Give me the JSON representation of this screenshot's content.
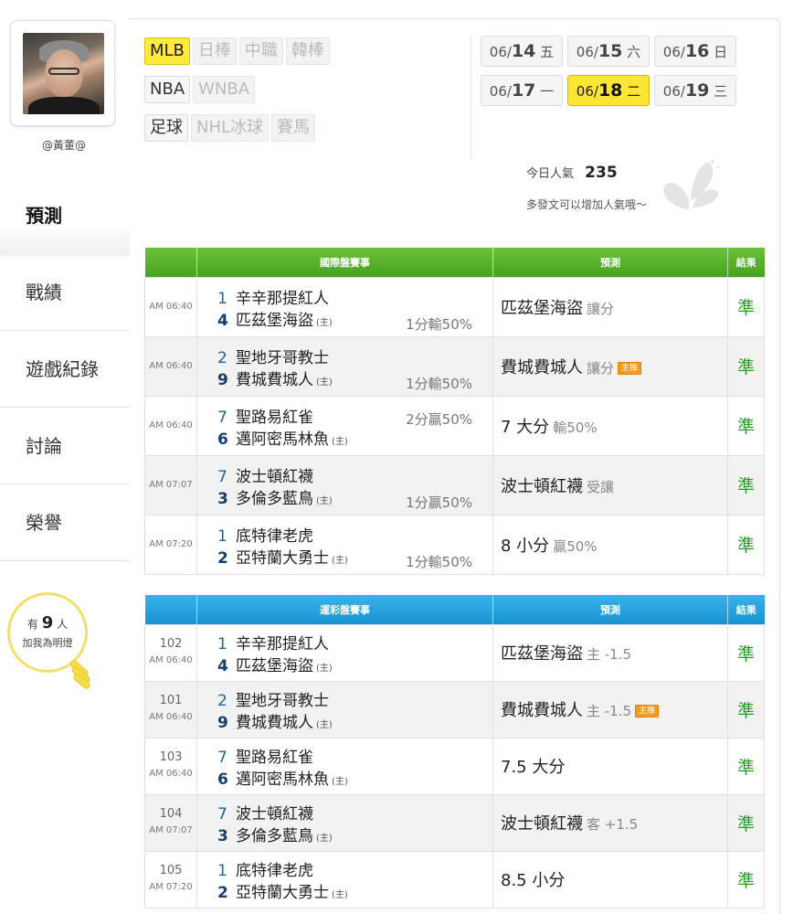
{
  "user": {
    "name": "@黃董@"
  },
  "nav": [
    {
      "label": "預測",
      "active": true
    },
    {
      "label": "戰績"
    },
    {
      "label": "遊戲紀錄"
    },
    {
      "label": "討論"
    },
    {
      "label": "榮譽"
    }
  ],
  "lamp": {
    "prefix": "有",
    "count": "9",
    "suffix": "人",
    "line2": "加我為明燈"
  },
  "sports": [
    {
      "label": "MLB",
      "state": "active"
    },
    {
      "label": "日棒",
      "state": "disabled"
    },
    {
      "label": "中職",
      "state": "disabled"
    },
    {
      "label": "韓棒",
      "state": "disabled"
    },
    {
      "label": "NBA",
      "state": "normal"
    },
    {
      "label": "WNBA",
      "state": "disabled"
    },
    {
      "label": "足球",
      "state": "normal"
    },
    {
      "label": "NHL冰球",
      "state": "disabled"
    },
    {
      "label": "賽馬",
      "state": "disabled"
    }
  ],
  "dates": [
    {
      "prefix": "06/",
      "day": "14",
      "wd": "五"
    },
    {
      "prefix": "06/",
      "day": "15",
      "wd": "六"
    },
    {
      "prefix": "06/",
      "day": "16",
      "wd": "日"
    },
    {
      "prefix": "06/",
      "day": "17",
      "wd": "一"
    },
    {
      "prefix": "06/",
      "day": "18",
      "wd": "二",
      "active": true
    },
    {
      "prefix": "06/",
      "day": "19",
      "wd": "三"
    }
  ],
  "popularity": {
    "label": "今日人氣",
    "value": "235",
    "hint": "多發文可以增加人氣哦～"
  },
  "intl": {
    "headers": {
      "event": "國際盤賽事",
      "pred": "預測",
      "result": "結果"
    },
    "rows": [
      {
        "time": "AM 06:40",
        "t1": "辛辛那提紅人",
        "s1": "1",
        "t2": "匹茲堡海盜",
        "s2": "4",
        "odds": "1分輸50%",
        "odds_pos": "bottom",
        "pred": "匹茲堡海盜",
        "pred_sub": "讓分",
        "badge": "",
        "result": "準"
      },
      {
        "time": "AM 06:40",
        "t1": "聖地牙哥教士",
        "s1": "2",
        "t2": "費城費城人",
        "s2": "9",
        "odds": "1分輸50%",
        "odds_pos": "bottom",
        "pred": "費城費城人",
        "pred_sub": "讓分",
        "badge": "主推",
        "result": "準"
      },
      {
        "time": "AM 06:40",
        "t1": "聖路易紅雀",
        "s1": "7",
        "t2": "邁阿密馬林魚",
        "s2": "6",
        "odds": "2分贏50%",
        "odds_pos": "top",
        "pred": "7 大分",
        "pred_sub": "輸50%",
        "badge": "",
        "result": "準"
      },
      {
        "time": "AM 07:07",
        "t1": "波士頓紅襪",
        "s1": "7",
        "t2": "多倫多藍鳥",
        "s2": "3",
        "odds": "1分贏50%",
        "odds_pos": "bottom",
        "pred": "波士頓紅襪",
        "pred_sub": "受讓",
        "badge": "",
        "result": "準"
      },
      {
        "time": "AM 07:20",
        "t1": "底特律老虎",
        "s1": "1",
        "t2": "亞特蘭大勇士",
        "s2": "2",
        "odds": "1分輸50%",
        "odds_pos": "bottom",
        "pred": "8 小分",
        "pred_sub": "贏50%",
        "badge": "",
        "result": "準"
      }
    ]
  },
  "lottery": {
    "headers": {
      "event": "運彩盤賽事",
      "pred": "預測",
      "result": "結果"
    },
    "rows": [
      {
        "num": "102",
        "time": "AM 06:40",
        "t1": "辛辛那提紅人",
        "s1": "1",
        "t2": "匹茲堡海盜",
        "s2": "4",
        "pred": "匹茲堡海盜",
        "pred_sub": "主 -1.5",
        "badge": "",
        "result": "準"
      },
      {
        "num": "101",
        "time": "AM 06:40",
        "t1": "聖地牙哥教士",
        "s1": "2",
        "t2": "費城費城人",
        "s2": "9",
        "pred": "費城費城人",
        "pred_sub": "主 -1.5",
        "badge": "主推",
        "result": "準"
      },
      {
        "num": "103",
        "time": "AM 06:40",
        "t1": "聖路易紅雀",
        "s1": "7",
        "t2": "邁阿密馬林魚",
        "s2": "6",
        "pred": "7.5 大分",
        "pred_sub": "",
        "badge": "",
        "result": "準"
      },
      {
        "num": "104",
        "time": "AM 07:07",
        "t1": "波士頓紅襪",
        "s1": "7",
        "t2": "多倫多藍鳥",
        "s2": "3",
        "pred": "波士頓紅襪",
        "pred_sub": "客 +1.5",
        "badge": "",
        "result": "準"
      },
      {
        "num": "105",
        "time": "AM 07:20",
        "t1": "底特律老虎",
        "s1": "1",
        "t2": "亞特蘭大勇士",
        "s2": "2",
        "pred": "8.5 小分",
        "pred_sub": "",
        "badge": "",
        "result": "準"
      }
    ]
  },
  "home_mark": "(主)",
  "colors": {
    "accent_yellow": "#ffe534",
    "green_header": "#45a11c",
    "blue_header": "#1794d2",
    "result_green": "#2a9a2a"
  }
}
